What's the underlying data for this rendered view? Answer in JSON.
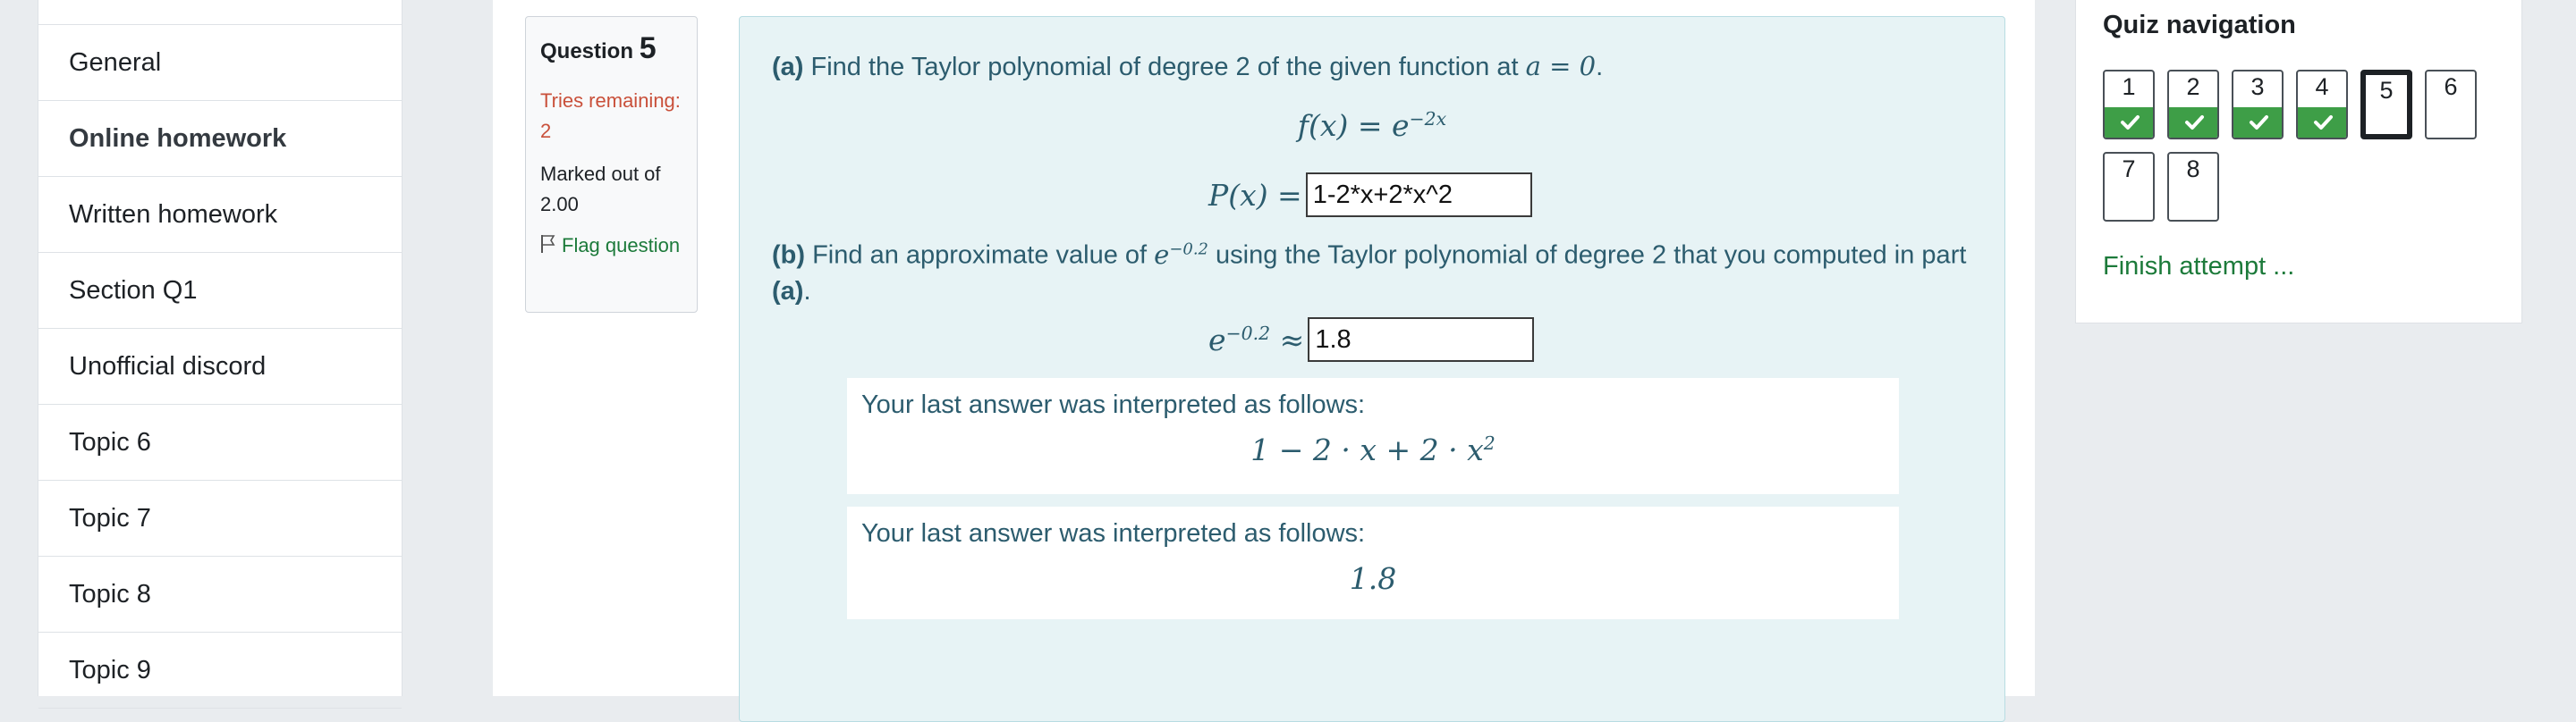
{
  "sidebar": {
    "items": [
      {
        "label": "General",
        "bold": false
      },
      {
        "label": "Online homework",
        "bold": true
      },
      {
        "label": "Written homework",
        "bold": false
      },
      {
        "label": "Section Q1",
        "bold": false
      },
      {
        "label": "Unofficial discord",
        "bold": false
      },
      {
        "label": "Topic 6",
        "bold": false
      },
      {
        "label": "Topic 7",
        "bold": false
      },
      {
        "label": "Topic 8",
        "bold": false
      },
      {
        "label": "Topic 9",
        "bold": false
      }
    ]
  },
  "question_info": {
    "prefix": "Question",
    "number": "5",
    "tries": "Tries remaining: 2",
    "marked": "Marked out of 2.00",
    "flag": "Flag question",
    "flag_icon": "flag-icon"
  },
  "question": {
    "part_a_label": "(a)",
    "part_a_text": "Find the Taylor polynomial of degree 2 of the given function at",
    "part_a_point": "a = 0",
    "function_lhs": "f(x) = e",
    "function_exp": "−2x",
    "p_label": "P(x) =",
    "p_answer": "1-2*x+2*x^2",
    "part_b_label": "(b)",
    "part_b_text1": "Find an approximate value of",
    "part_b_text2": "using the Taylor polynomial of degree 2 that you computed in part",
    "part_b_ref": "(a)",
    "e_base": "e",
    "e_exp": "−0.2",
    "approx": "≈",
    "e_answer": "1.8",
    "interp_title": "Your last answer was interpreted as follows:",
    "interp_1": "1 − 2 · x + 2 · x",
    "interp_1_exp": "2",
    "interp_2": "1.8"
  },
  "quiz_nav": {
    "title": "Quiz navigation",
    "buttons": [
      {
        "label": "1",
        "state": "answered"
      },
      {
        "label": "2",
        "state": "answered"
      },
      {
        "label": "3",
        "state": "answered"
      },
      {
        "label": "4",
        "state": "answered"
      },
      {
        "label": "5",
        "state": "current"
      },
      {
        "label": "6",
        "state": "unanswered"
      },
      {
        "label": "7",
        "state": "unanswered"
      },
      {
        "label": "8",
        "state": "unanswered"
      }
    ],
    "finish": "Finish attempt ...",
    "answered_color": "#3e9e47",
    "check_icon": "check-icon"
  }
}
